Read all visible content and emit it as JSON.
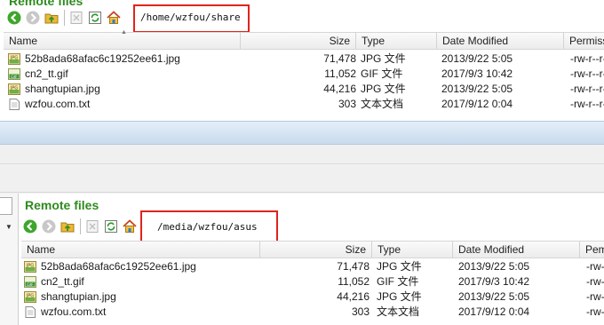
{
  "top": {
    "title": "Remote files",
    "path": "/home/wzfou/share",
    "columns": {
      "name": "Name",
      "size": "Size",
      "type": "Type",
      "modified": "Date Modified",
      "perm": "Permissi"
    },
    "files": [
      {
        "icon": "jpg-file-icon",
        "name": "52b8ada68afac6c19252ee61.jpg",
        "size": "71,478",
        "type": "JPG 文件",
        "modified": "2013/9/22 5:05",
        "perm": "-rw-r--r--"
      },
      {
        "icon": "gif-file-icon",
        "name": "cn2_tt.gif",
        "size": "11,052",
        "type": "GIF 文件",
        "modified": "2017/9/3 10:42",
        "perm": "-rw-r--r--"
      },
      {
        "icon": "jpg-file-icon",
        "name": "shangtupian.jpg",
        "size": "44,216",
        "type": "JPG 文件",
        "modified": "2013/9/22 5:05",
        "perm": "-rw-r--r--"
      },
      {
        "icon": "txt-file-icon",
        "name": "wzfou.com.txt",
        "size": "303",
        "type": "文本文档",
        "modified": "2017/9/12 0:04",
        "perm": "-rw-r--r--"
      }
    ]
  },
  "bottom": {
    "title": "Remote files",
    "path": "/media/wzfou/asus",
    "columns": {
      "name": "Name",
      "size": "Size",
      "type": "Type",
      "modified": "Date Modified",
      "perm": "Pem"
    },
    "files": [
      {
        "icon": "jpg-file-icon",
        "name": "52b8ada68afac6c19252ee61.jpg",
        "size": "71,478",
        "type": "JPG 文件",
        "modified": "2013/9/22 5:05",
        "perm": "-rw-r"
      },
      {
        "icon": "gif-file-icon",
        "name": "cn2_tt.gif",
        "size": "11,052",
        "type": "GIF 文件",
        "modified": "2017/9/3 10:42",
        "perm": "-rw-r"
      },
      {
        "icon": "jpg-file-icon",
        "name": "shangtupian.jpg",
        "size": "44,216",
        "type": "JPG 文件",
        "modified": "2013/9/22 5:05",
        "perm": "-rw-r"
      },
      {
        "icon": "txt-file-icon",
        "name": "wzfou.com.txt",
        "size": "303",
        "type": "文本文档",
        "modified": "2017/9/12 0:04",
        "perm": "-rw-r"
      }
    ]
  },
  "colors": {
    "title_green": "#2f8a1f",
    "highlight_red": "#e0241b",
    "divider_blue": "#c9dbee"
  }
}
